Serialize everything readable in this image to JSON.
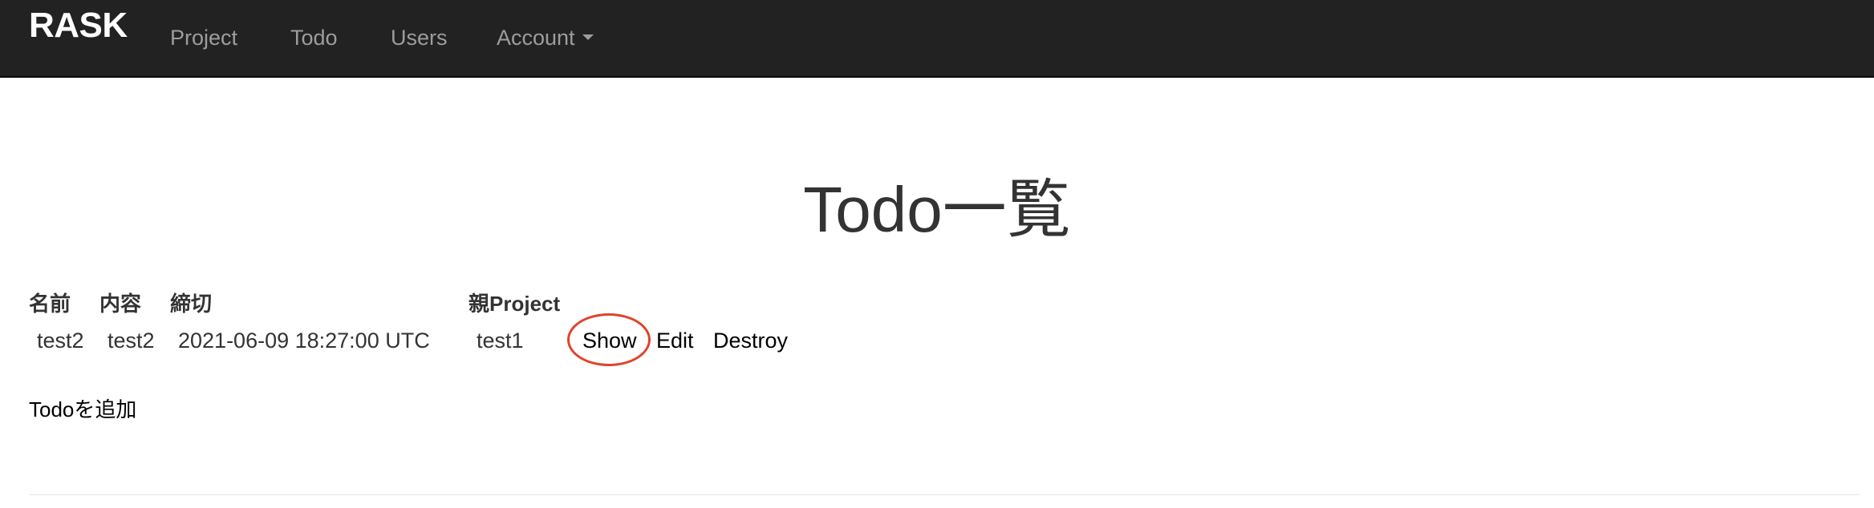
{
  "navbar": {
    "brand": "RASK",
    "items": [
      {
        "label": "Project"
      },
      {
        "label": "Todo"
      },
      {
        "label": "Users"
      },
      {
        "label": "Account"
      }
    ],
    "background": "#222222",
    "link_color": "#9d9d9d"
  },
  "page": {
    "title": "Todo一覧"
  },
  "table": {
    "headers": [
      "名前",
      "内容",
      "締切",
      "親Project"
    ],
    "rows": [
      {
        "name": "test2",
        "content": "test2",
        "deadline": "2021-06-09 18:27:00 UTC",
        "parent": "test1",
        "actions": [
          "Show",
          "Edit",
          "Destroy"
        ]
      }
    ]
  },
  "actions": {
    "add_todo": "Todoを追加"
  },
  "annotation": {
    "highlighted": "Show",
    "color": "#e0442a"
  }
}
